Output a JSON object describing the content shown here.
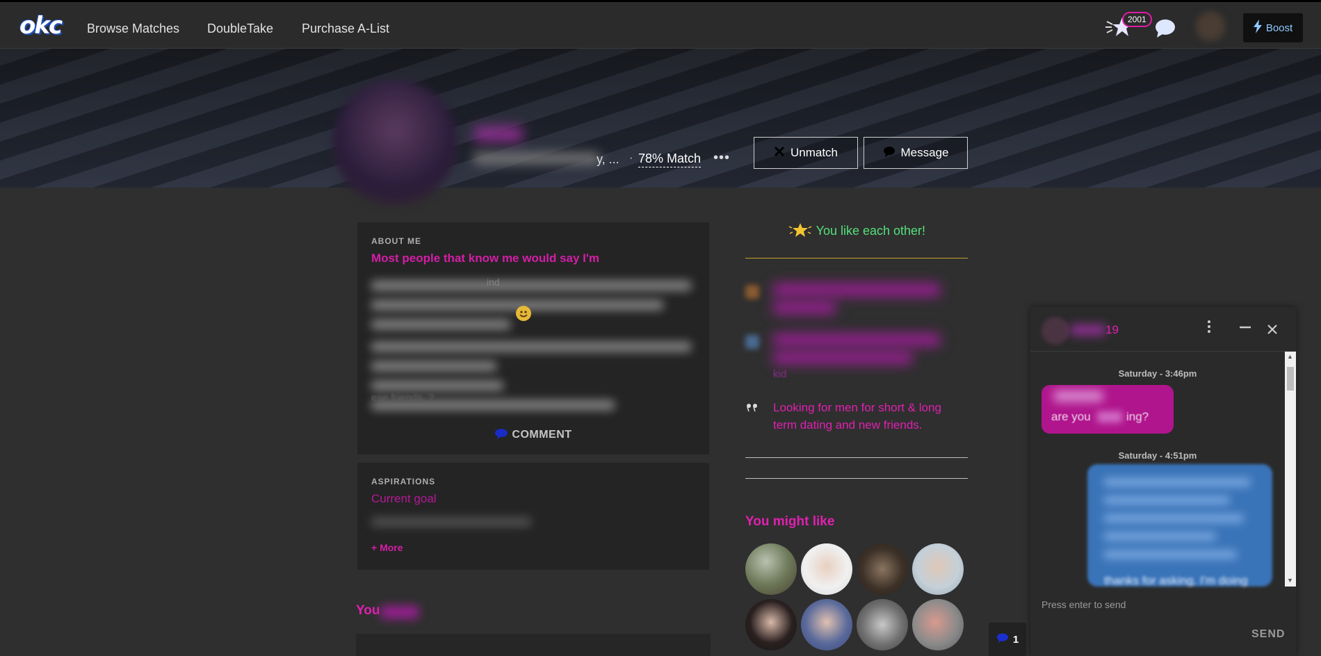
{
  "nav": {
    "logo": "okc",
    "links": [
      "Browse Matches",
      "DoubleTake",
      "Purchase A-List"
    ],
    "likes_count": "2001",
    "boost_label": "Boost"
  },
  "profile": {
    "meta_tail": "y, ...",
    "separator": "·",
    "match": "78% Match",
    "more": "•••",
    "unmatch_label": "Unmatch",
    "message_label": "Message"
  },
  "about": {
    "label": "ABOUT ME",
    "question": "Most people that know me would say I'm",
    "snippet": "ind",
    "tail_text": "ese friends. ?",
    "comment_label": "COMMENT"
  },
  "aspirations": {
    "label": "ASPIRATIONS",
    "question": "Current goal",
    "more_label": "+ More"
  },
  "right": {
    "like_each_other": "You like each other!",
    "detail_tail": "kid",
    "looking_for": "Looking for men for short & long term dating and new friends.",
    "might_like": "You might like"
  },
  "you_section": "You",
  "notif_count": "1",
  "chat": {
    "age": "19",
    "day1": "Saturday - 3:46pm",
    "msg1_visible": "are you",
    "msg1_tail": "ing?",
    "day2": "Saturday - 4:51pm",
    "msg2_tail": "thanks for asking. I'm doing",
    "input_placeholder": "Press enter to send",
    "send_label": "SEND"
  },
  "colors": {
    "accent_pink": "#e020b0",
    "match_green": "#55e07a",
    "gold_rule": "#c9a32c",
    "bubble_out": "#3a74b8",
    "bubble_in": "#b0158d"
  }
}
